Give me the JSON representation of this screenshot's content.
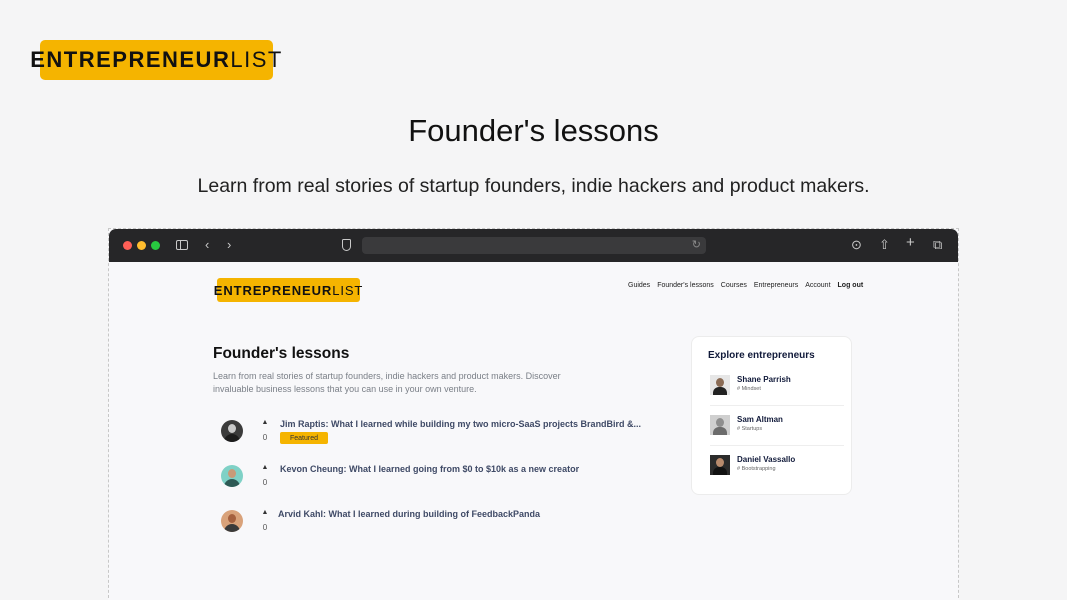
{
  "brand": {
    "logo_bold": "ENTREPRENEUR",
    "logo_light": "LIST"
  },
  "hero": {
    "title": "Founder's lessons",
    "subtitle": "Learn from real stories of startup founders, indie hackers and product makers."
  },
  "browser": {
    "icons": [
      "sidebar-icon",
      "back-icon",
      "forward-icon",
      "shield-icon",
      "reload-icon",
      "download-icon",
      "share-icon",
      "plus-icon",
      "tabs-icon"
    ]
  },
  "site": {
    "logo_bold": "ENTREPRENEUR",
    "logo_light": "LIST",
    "nav": [
      "Guides",
      "Founder's lessons",
      "Courses",
      "Entrepreneurs",
      "Account",
      "Log out"
    ]
  },
  "page": {
    "title": "Founder's lessons",
    "description": "Learn from real stories of startup founders, indie hackers and product makers. Discover invaluable business lessons that you can use in your own venture."
  },
  "lessons": [
    {
      "votes": "0",
      "title": "Jim Raptis: What I learned while building my two micro-SaaS projects BrandBird &...",
      "badge": "Featured"
    },
    {
      "votes": "0",
      "title": "Kevon Cheung: What I learned going from $0 to $10k as a new creator",
      "badge": ""
    },
    {
      "votes": "0",
      "title": "Arvid Kahl: What I learned during building of FeedbackPanda",
      "badge": ""
    }
  ],
  "explore": {
    "title": "Explore entrepreneurs",
    "items": [
      {
        "name": "Shane Parrish",
        "tag": "# Mindset"
      },
      {
        "name": "Sam Altman",
        "tag": "# Startups"
      },
      {
        "name": "Daniel Vassallo",
        "tag": "# Bootstrapping"
      }
    ]
  },
  "colors": {
    "accent": "#f5b400",
    "chrome": "#262628",
    "link": "#3f4a66"
  }
}
